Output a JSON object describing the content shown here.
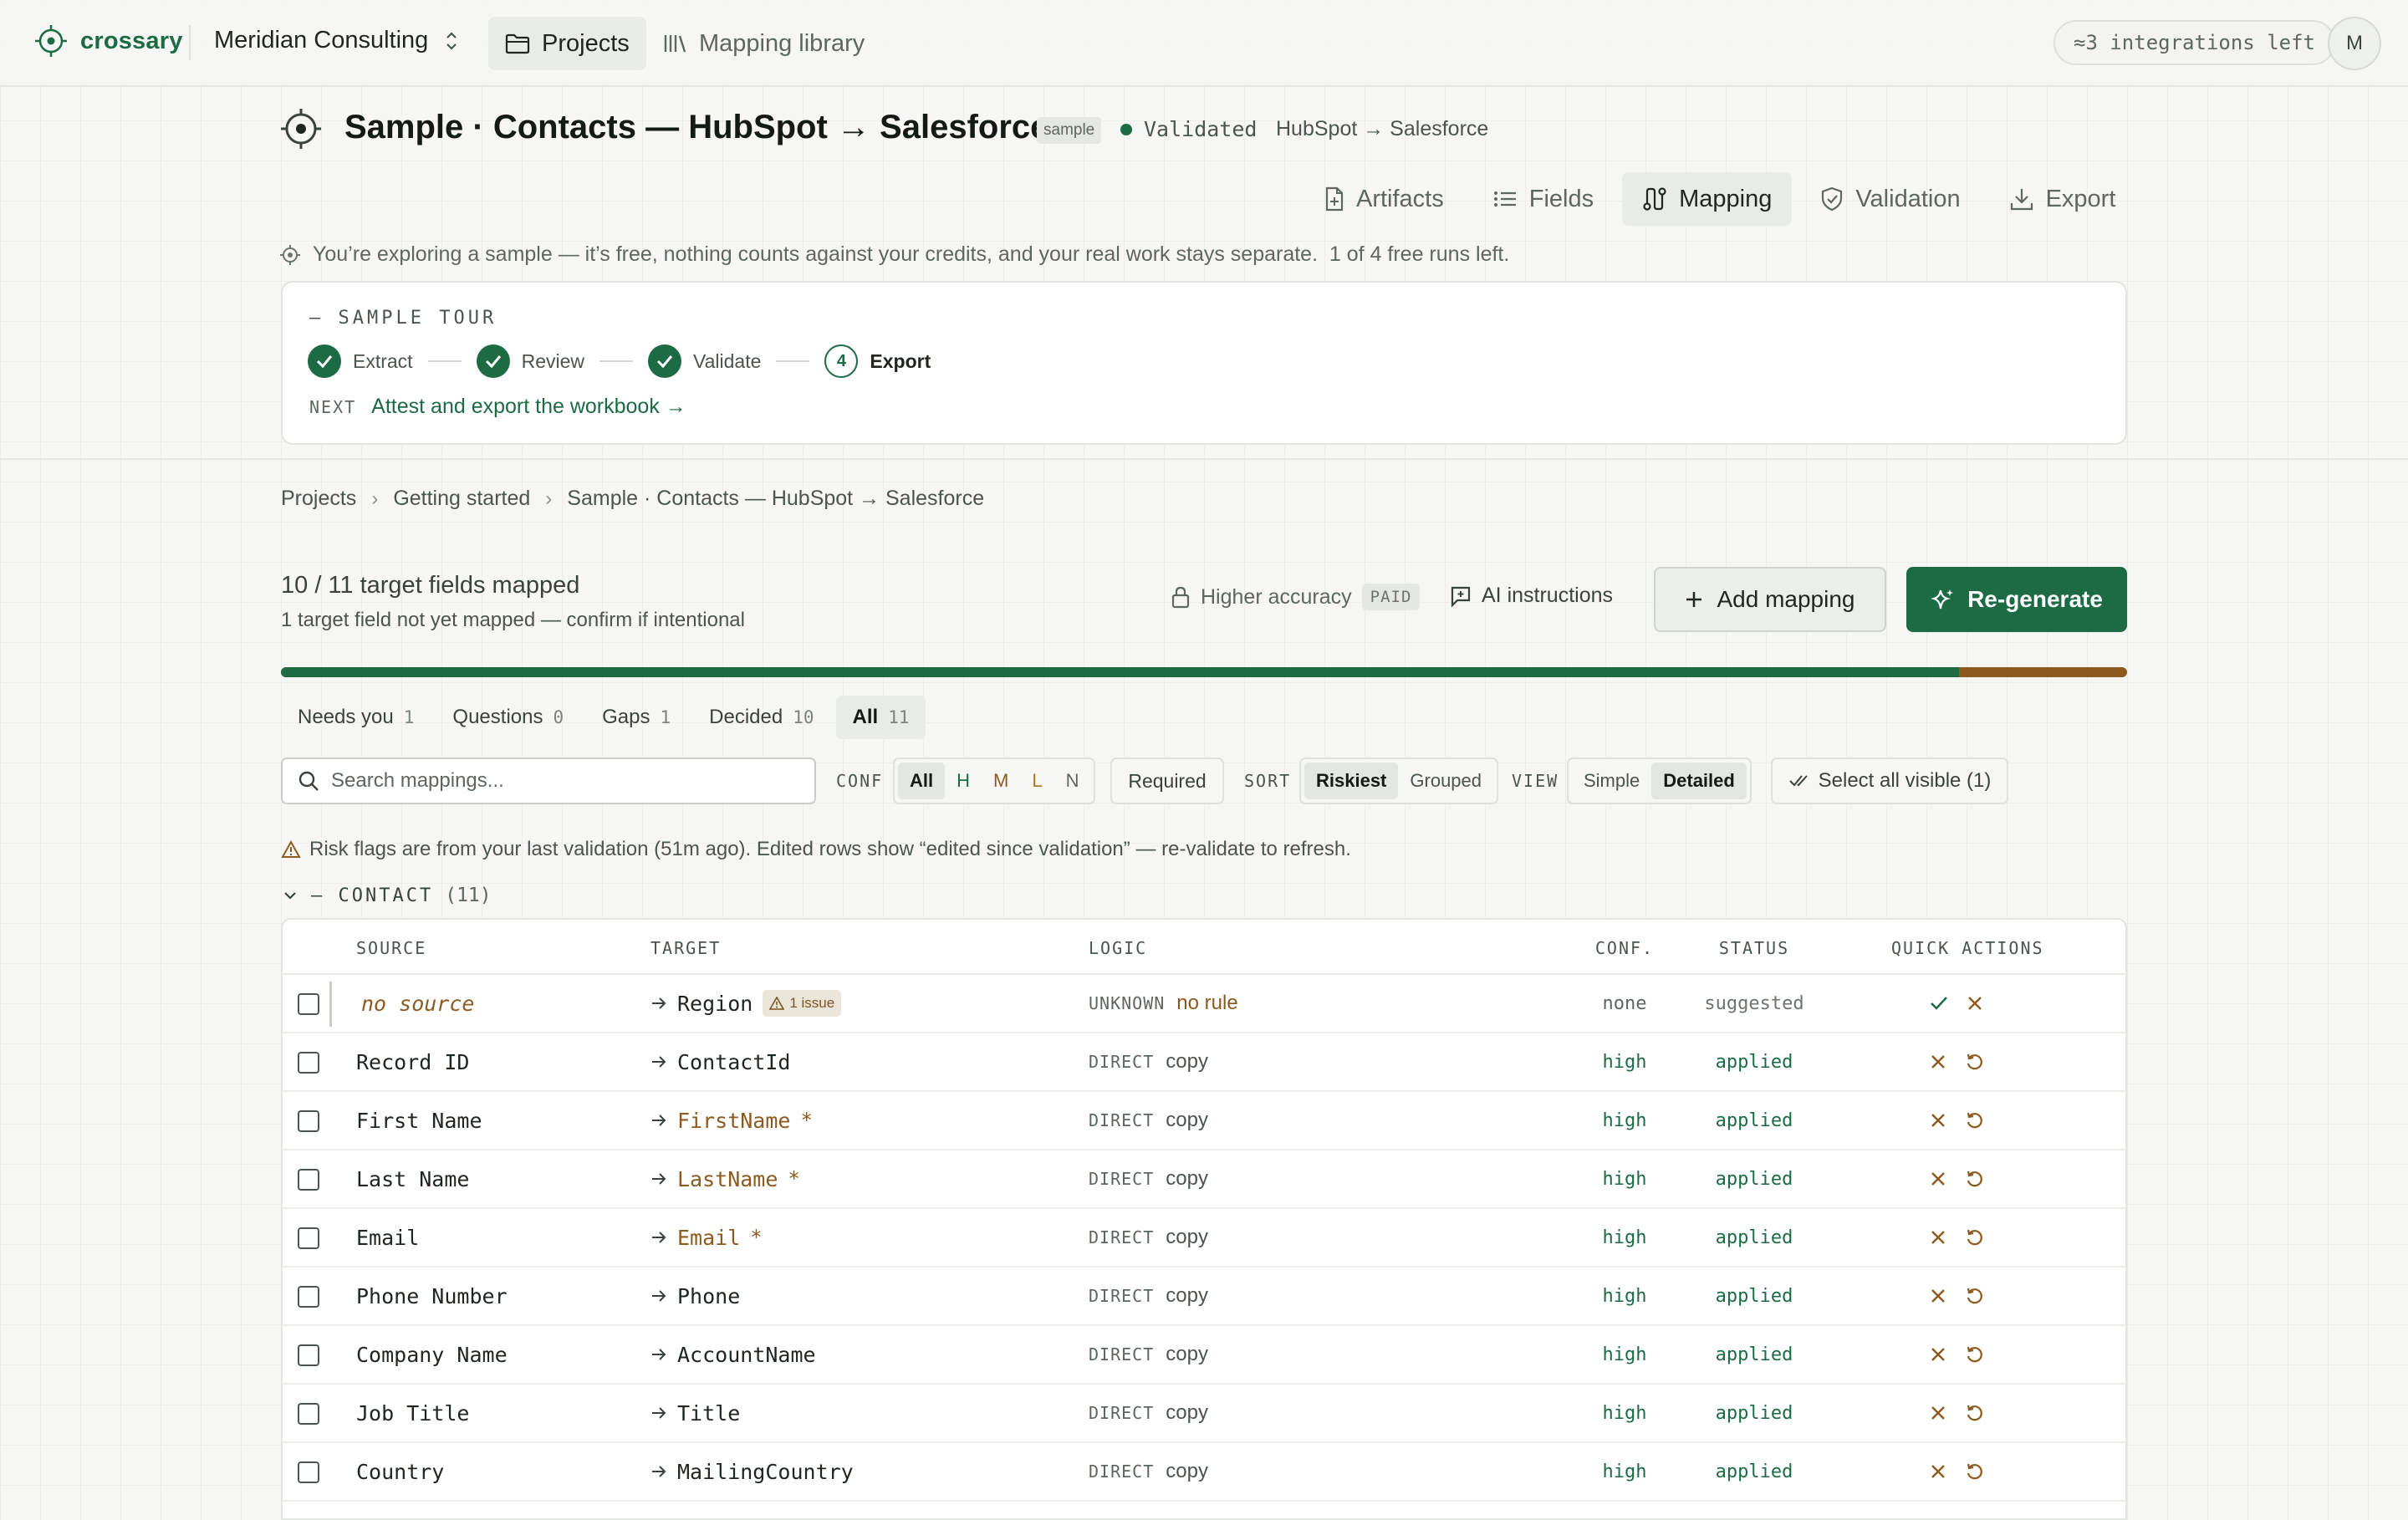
{
  "app": {
    "brand": "crossary",
    "workspace": "Meridian Consulting",
    "nav": {
      "projects": "Projects",
      "library": "Mapping library"
    },
    "integrations": "≈3 integrations left",
    "avatar": "M"
  },
  "project": {
    "title": "Sample · Contacts — HubSpot → Salesforce",
    "badge": "sample",
    "status": "Validated",
    "path": "HubSpot → Salesforce",
    "tabs": [
      "Artifacts",
      "Fields",
      "Mapping",
      "Validation",
      "Export"
    ],
    "active_tab": "Mapping"
  },
  "notice": "You’re exploring a sample — it’s free, nothing counts against your credits, and your real work stays separate.  1 of 4 free runs left.",
  "tour": {
    "label": "— SAMPLE TOUR",
    "steps": [
      "Extract",
      "Review",
      "Validate",
      "Export"
    ],
    "current_number": "4",
    "next_label": "NEXT",
    "next_text": "Attest and export the workbook →"
  },
  "breadcrumb": [
    "Projects",
    "Getting started",
    "Sample · Contacts — HubSpot → Salesforce"
  ],
  "summary": {
    "mapped": "10 / 11 target fields mapped",
    "sub": "1 target field not yet mapped — confirm if intentional",
    "higher_accuracy": "Higher accuracy",
    "paid": "PAID",
    "ai_instructions": "AI instructions",
    "add_mapping": "Add mapping",
    "regenerate": "Re-generate",
    "progress_fraction": 0.909
  },
  "filters": [
    {
      "label": "Needs you",
      "count": "1"
    },
    {
      "label": "Questions",
      "count": "0"
    },
    {
      "label": "Gaps",
      "count": "1"
    },
    {
      "label": "Decided",
      "count": "10"
    },
    {
      "label": "All",
      "count": "11"
    }
  ],
  "toolbar": {
    "search_placeholder": "Search mappings...",
    "conf_label": "CONF",
    "conf_options": [
      "All",
      "H",
      "M",
      "L",
      "N"
    ],
    "required": "Required",
    "sort_label": "SORT",
    "sort_options": [
      "Riskiest",
      "Grouped"
    ],
    "view_label": "VIEW",
    "view_options": [
      "Simple",
      "Detailed"
    ],
    "select_all": "Select all visible (1)"
  },
  "risk_note": "Risk flags are from your last validation (51m ago). Edited rows show “edited since validation” — re-validate to refresh.",
  "group": {
    "name": "— CONTACT",
    "count": "(11)"
  },
  "columns": [
    "SOURCE",
    "TARGET",
    "LOGIC",
    "CONF.",
    "STATUS",
    "QUICK ACTIONS"
  ],
  "rows": [
    {
      "source": "no source",
      "target": "Region",
      "issue": "1 issue",
      "kind": "UNKNOWN",
      "op": "no rule",
      "conf": "none",
      "status": "suggested"
    },
    {
      "source": "Record ID",
      "target": "ContactId",
      "kind": "DIRECT",
      "op": "copy",
      "conf": "high",
      "status": "applied"
    },
    {
      "source": "First Name",
      "target": "FirstName",
      "star": "*",
      "kind": "DIRECT",
      "op": "copy",
      "conf": "high",
      "status": "applied"
    },
    {
      "source": "Last Name",
      "target": "LastName",
      "star": "*",
      "kind": "DIRECT",
      "op": "copy",
      "conf": "high",
      "status": "applied"
    },
    {
      "source": "Email",
      "target": "Email",
      "star": "*",
      "kind": "DIRECT",
      "op": "copy",
      "conf": "high",
      "status": "applied"
    },
    {
      "source": "Phone Number",
      "target": "Phone",
      "kind": "DIRECT",
      "op": "copy",
      "conf": "high",
      "status": "applied"
    },
    {
      "source": "Company Name",
      "target": "AccountName",
      "kind": "DIRECT",
      "op": "copy",
      "conf": "high",
      "status": "applied"
    },
    {
      "source": "Job Title",
      "target": "Title",
      "kind": "DIRECT",
      "op": "copy",
      "conf": "high",
      "status": "applied"
    },
    {
      "source": "Country",
      "target": "MailingCountry",
      "kind": "DIRECT",
      "op": "copy",
      "conf": "high",
      "status": "applied"
    }
  ],
  "colors": {
    "accent": "#1d6b45",
    "warning": "#8c5a1f",
    "background": "#f6f7f5"
  }
}
